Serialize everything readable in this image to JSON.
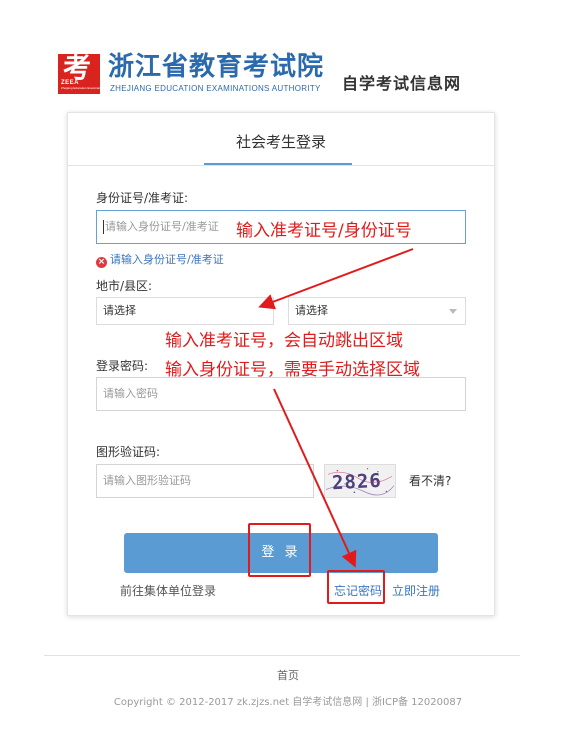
{
  "header": {
    "logo_glyph": "考",
    "logo_tag": "ZEEA",
    "logo_sub": "Zhejiang Education Examinations Authority",
    "org_name_cn": "浙江省教育考试院",
    "org_name_en": "ZHEJIANG EDUCATION EXAMINATIONS AUTHORITY",
    "site_name": "自学考试信息网"
  },
  "login": {
    "title": "社会考生登录",
    "id_label": "身份证号/准考证:",
    "id_placeholder": "请输入身份证号/准考证",
    "id_error": "请输入身份证号/准考证",
    "region_label": "地市/县区:",
    "city_select": "请选择",
    "county_select": "请选择",
    "password_label": "登录密码:",
    "password_placeholder": "请输入密码",
    "captcha_label": "图形验证码:",
    "captcha_placeholder": "请输入图形验证码",
    "captcha_text": "2826",
    "refresh_text": "看不清?",
    "submit_label": "登 录",
    "group_login_link": "前往集体单位登录",
    "forgot_password_link": "忘记密码",
    "register_link": "立即注册"
  },
  "annotations": {
    "note_input": "输入准考证号/身份证号",
    "note_line1": "输入准考证号，会自动跳出区域",
    "note_line2": "输入身份证号，需要手动选择区域"
  },
  "footer": {
    "home_link": "首页",
    "copyright": "Copyright © 2012-2017 zk.zjzs.net 自学考试信息网  |  浙ICP备 12020087"
  },
  "colors": {
    "brand_blue": "#2b6aad",
    "button_blue": "#5a9bd4",
    "annotation_red": "#e11b1b",
    "logo_red": "#d8231e"
  }
}
